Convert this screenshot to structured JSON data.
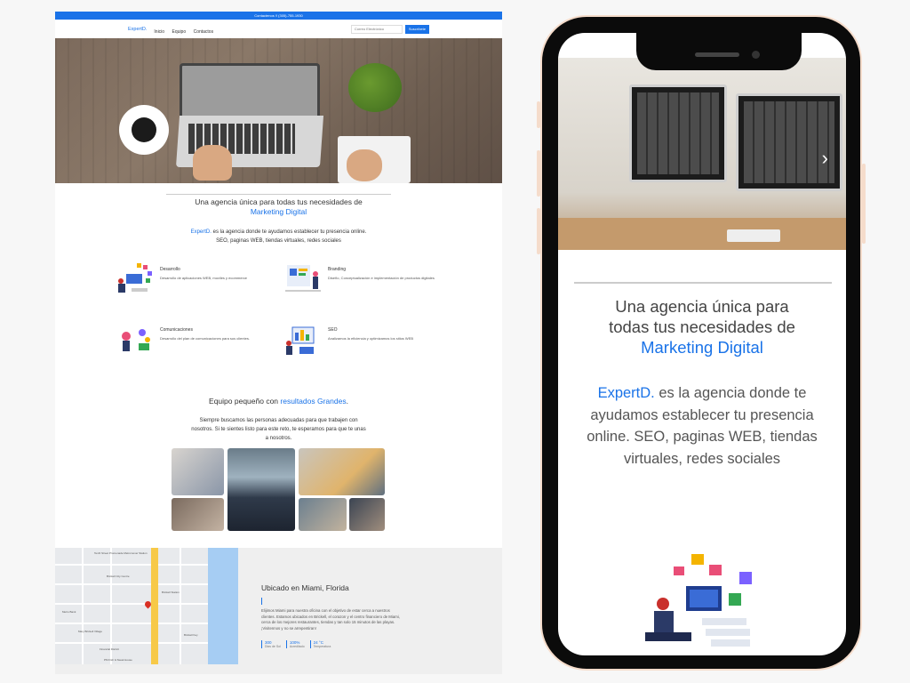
{
  "desktop": {
    "topbar": "Contactenos !! (305)-755-1930",
    "brand": "ExpertD.",
    "nav": [
      "Inicio",
      "Equipo",
      "Contactos"
    ],
    "email_placeholder": "Correo Electrónico",
    "subscribe": "Suscríbete",
    "headline_line1": "Una agencia única para todas tus necesidades de",
    "headline_line2": "Marketing Digital",
    "lead_brand": "ExpertD.",
    "lead_text": " es la agencia donde te ayudamos establecer tu presencia online.",
    "lead_text2": "SEO, paginas WEB, tiendas virtuales, redes sociales",
    "services": [
      {
        "title": "Desarrollo",
        "desc": "Desarrollo de aplicaciones WEB, moviles y ecommerce"
      },
      {
        "title": "Branding",
        "desc": "Diseño, Conceptualización e implementación de productos digitales"
      },
      {
        "title": "Comunicaciones",
        "desc": "Desarrollo del plan de comunicaciones para sus clientes."
      },
      {
        "title": "SEO",
        "desc": "Analizamos la eficiencia y optimizamos los sitios WEB"
      }
    ],
    "team_title_a": "Equipo pequeño con ",
    "team_title_b": "resultados Grandes",
    "team_title_c": ".",
    "team_text": "Siempre buscamos las personas adecuadas para que trabajen con nosotros. Si te sientes listo para este reto, te esperamos para que te unas a nosotros.",
    "location_title": "Ubicado en Miami, Florida",
    "location_text": "Elijimos Miami para nuestra oficina con el objetivo de estar cerca a nuestros clientes. Estamos ubicados en Brickell, el corazon y el centro financiero de Miami, cerca de los mejores restaurantes, tiendas y tan solo 15 minutos de las playas. ¡Visitennos y no se arrepentiran!",
    "stats": [
      {
        "num": "300",
        "lbl": "Dias de Sol"
      },
      {
        "num": "100%",
        "lbl": "Acreditado"
      },
      {
        "num": "24 °C",
        "lbl": "Temperatura"
      }
    ],
    "map_labels": [
      "Tenth Street Promenade Metromover Station",
      "Brickell Station",
      "Metro Bank",
      "Brickell City Centre",
      "Mary Brickell Village",
      "Financial District",
      "Brickell Key",
      "PM Fish & Steak House"
    ]
  },
  "phone": {
    "headline_line1": "Una agencia única para",
    "headline_line2": "todas tus necesidades de",
    "headline_line3": "Marketing Digital",
    "lead_brand": "ExpertD.",
    "lead_text": " es la agencia donde te ayudamos establecer tu presencia online. SEO, paginas WEB, tiendas virtuales, redes sociales",
    "carousel_next": "›"
  },
  "colors": {
    "accent": "#1a73e8",
    "phone_frame": "#0b0b0b",
    "phone_bezel": "#f5dccb"
  }
}
